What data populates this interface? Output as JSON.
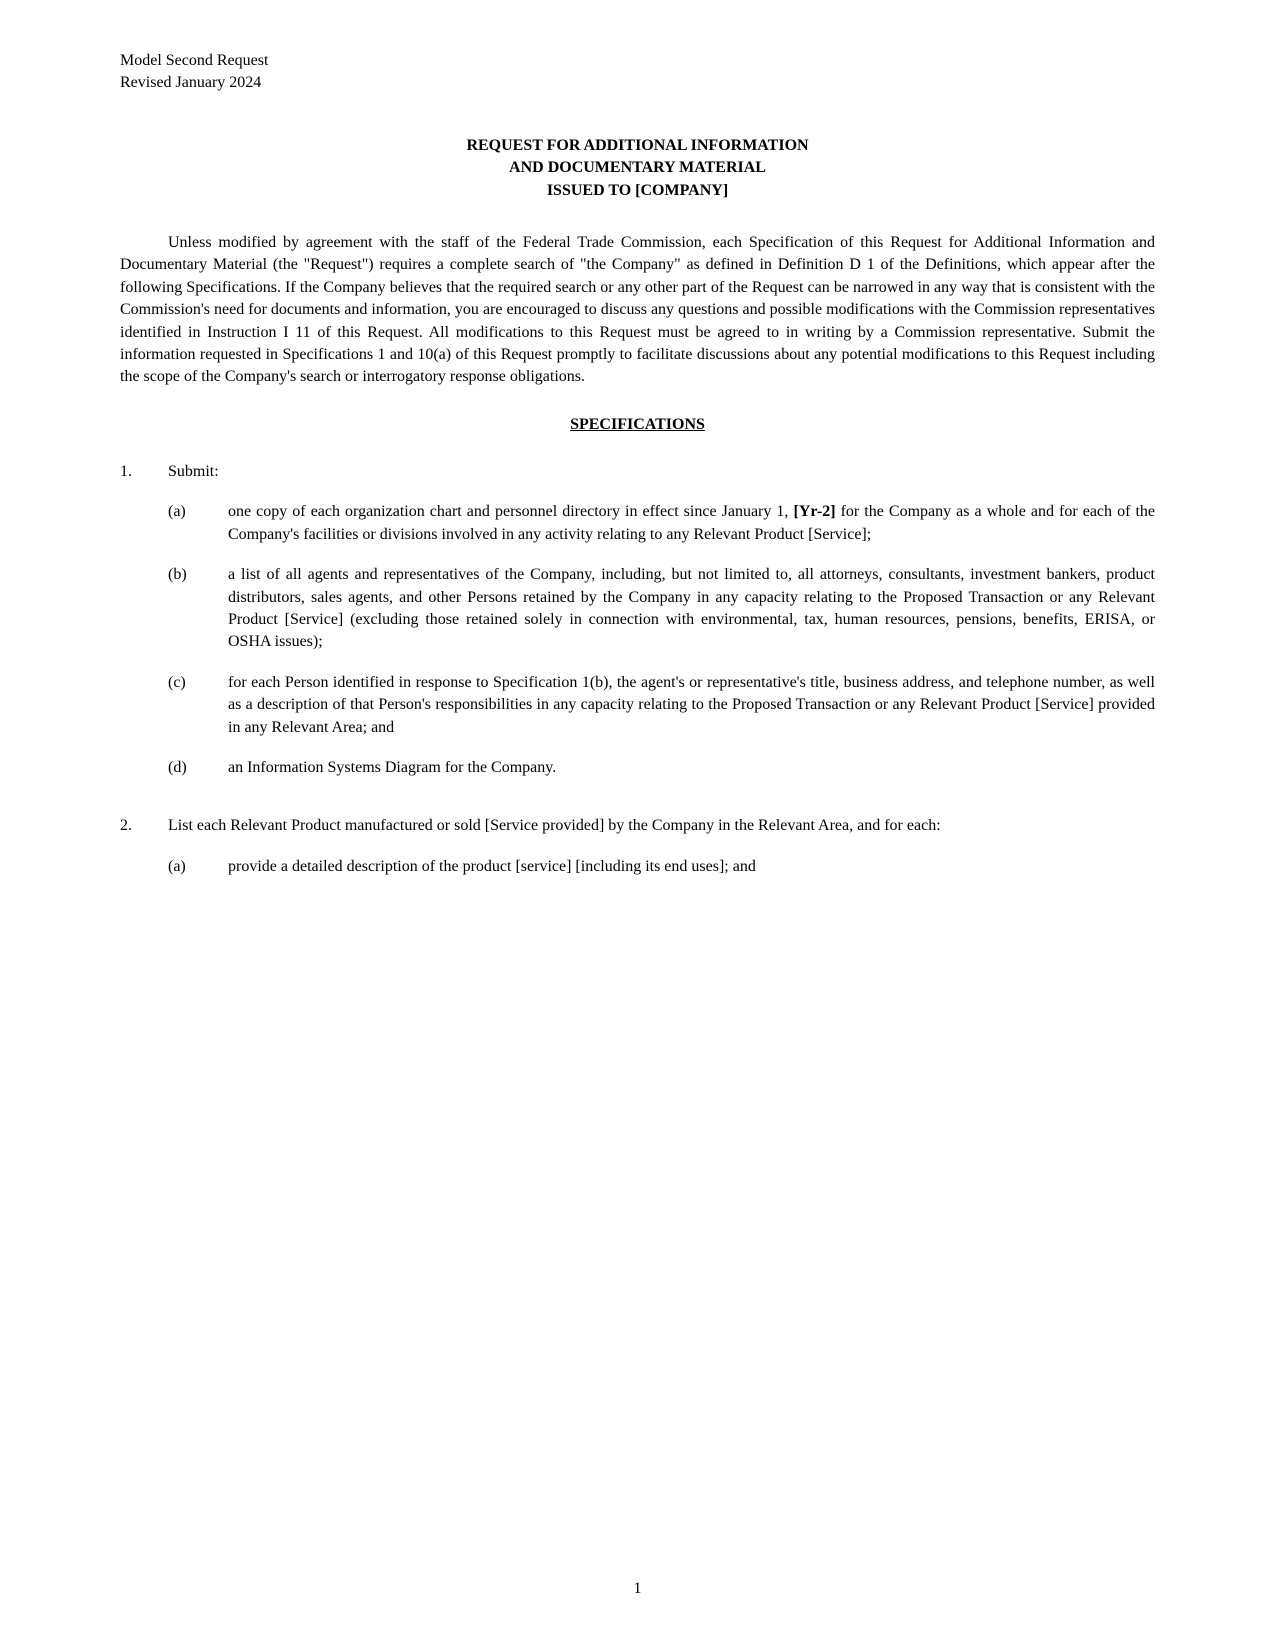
{
  "header": {
    "line1": "Model Second Request",
    "line2": "Revised January 2024"
  },
  "title": {
    "line1": "REQUEST FOR ADDITIONAL INFORMATION",
    "line2": "AND DOCUMENTARY MATERIAL",
    "line3": "ISSUED TO [COMPANY]"
  },
  "intro": "Unless modified by agreement with the staff of the Federal Trade Commission, each Specification of this Request for Additional Information and Documentary Material (the \"Request\") requires a complete search of \"the Company\" as defined in Definition D 1 of the Definitions, which appear after the following Specifications. If the Company believes that the required search or any other part of the Request can be narrowed in any way that is consistent with the Commission's need for documents and information, you are encouraged to discuss any questions and possible modifications with the Commission representatives identified in Instruction I 11 of this Request. All modifications to this Request must be agreed to in writing by a Commission representative. Submit the information requested in Specifications 1 and 10(a) of this Request promptly to facilitate discussions about any potential modifications to this Request including the scope of the Company's search or interrogatory response obligations.",
  "section_heading": "SPECIFICATIONS",
  "specs": [
    {
      "num": "1.",
      "intro": "Submit:",
      "subs": [
        {
          "label": "(a)",
          "text_before": "one copy of each organization chart and personnel directory in effect since January 1, ",
          "bold": "[Yr-2]",
          "text_after": " for the Company as a whole and for each of the Company's facilities or divisions involved in any activity relating to any Relevant Product [Service];"
        },
        {
          "label": "(b)",
          "text": "a list of all agents and representatives of the Company, including, but not limited to, all attorneys, consultants, investment bankers, product distributors, sales agents, and other Persons retained by the Company in any capacity relating to the Proposed Transaction or any Relevant Product [Service] (excluding those retained solely in connection with environmental, tax, human resources, pensions, benefits, ERISA, or OSHA issues);"
        },
        {
          "label": "(c)",
          "text": "for each Person identified in response to Specification 1(b), the agent's or representative's title, business address, and telephone number, as well as a description of that Person's responsibilities in any capacity relating to the Proposed Transaction or any Relevant Product [Service] provided in any Relevant Area; and"
        },
        {
          "label": "(d)",
          "text": "an Information Systems Diagram for the Company."
        }
      ]
    },
    {
      "num": "2.",
      "intro": "List each Relevant Product manufactured or sold [Service provided] by the Company in the Relevant Area, and for each:",
      "subs": [
        {
          "label": "(a)",
          "text": "provide a detailed description of the product [service] [including its end uses]; and"
        }
      ]
    }
  ],
  "page_num": "1"
}
